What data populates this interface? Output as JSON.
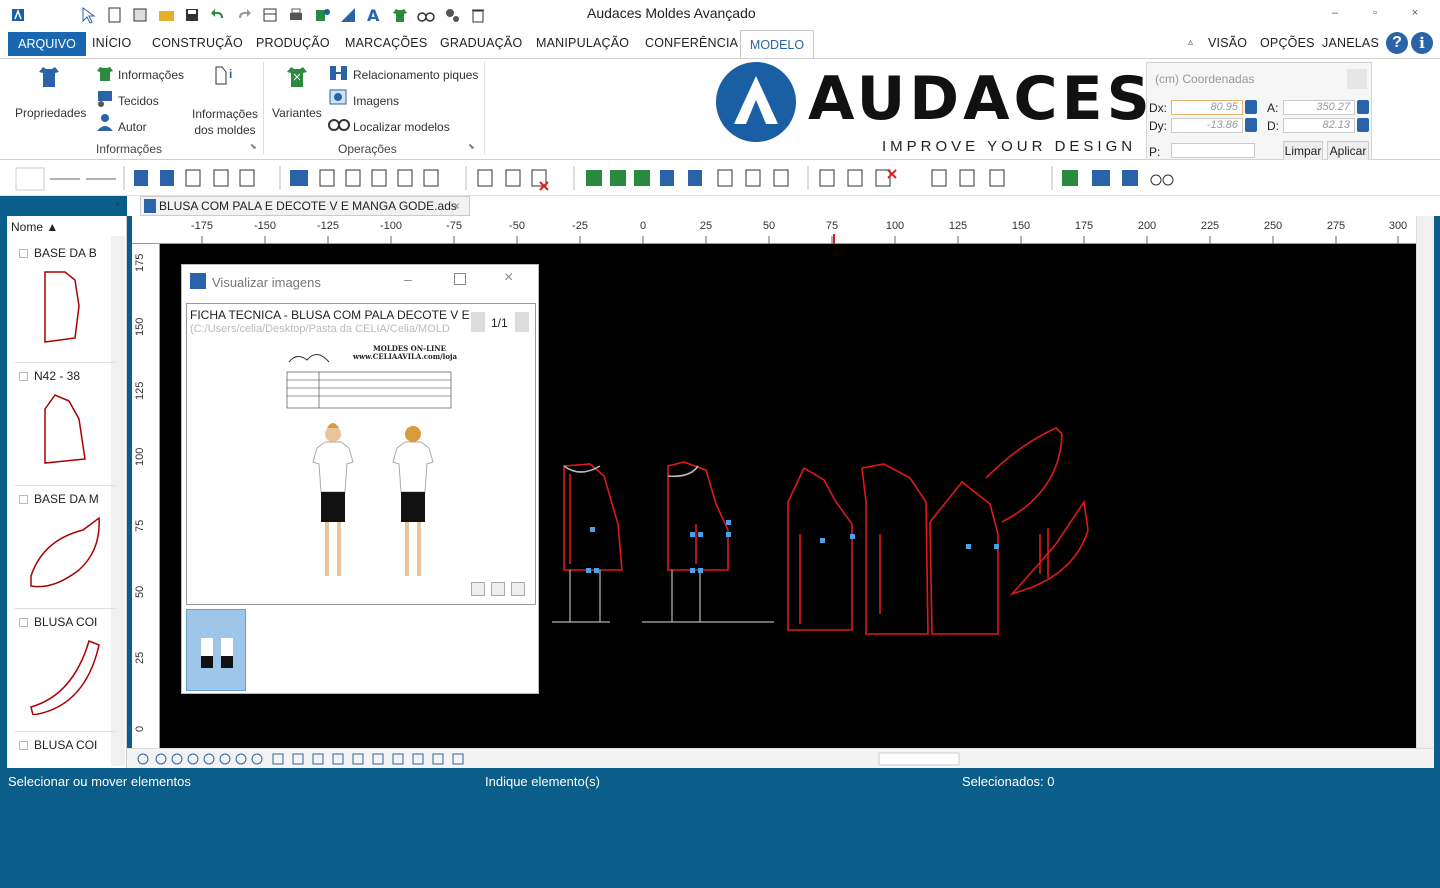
{
  "app": {
    "title": "Audaces Moldes Avançado",
    "minimize": "–",
    "restore": "▫",
    "close": "×"
  },
  "ribbon_tabs": [
    "ARQUIVO",
    "INÍCIO",
    "CONSTRUÇÃO",
    "PRODUÇÃO",
    "MARCAÇÕES",
    "GRADUAÇÃO",
    "MANIPULAÇÃO",
    "CONFERÊNCIA",
    "MODELO"
  ],
  "active_tab": "MODELO",
  "right_menu": {
    "visao": "VISÃO",
    "opcoes": "OPÇÕES",
    "janelas": "JANELAS"
  },
  "ribbon": {
    "propriedades": "Propriedades",
    "informacoes": "Informações",
    "tecidos": "Tecidos",
    "autor": "Autor",
    "informacoes_moldes": "Informações dos moldes",
    "group_informacoes": "Informações",
    "variantes": "Variantes",
    "relacionamento": "Relacionamento piques",
    "imagens": "Imagens",
    "localizar": "Localizar modelos",
    "group_operacoes": "Operações"
  },
  "logo": {
    "word": "AUDACES",
    "tagline": "IMPROVE YOUR DESIGN"
  },
  "coords": {
    "header": "(cm) Coordenadas",
    "dx_label": "Dx:",
    "dx": "80.95",
    "dy_label": "Dy:",
    "dy": "-13.86",
    "a_label": "A:",
    "a": "350.27",
    "d_label": "D:",
    "d": "82.13",
    "p_label": "P:",
    "limpar": "Limpar",
    "aplicar": "Aplicar"
  },
  "left_panel": {
    "header": "Nome",
    "items": [
      {
        "label": "BASE DA B"
      },
      {
        "label": "N42 - 38"
      },
      {
        "label": "BASE DA M"
      },
      {
        "label": "BLUSA COI"
      },
      {
        "label": "BLUSA COI"
      }
    ]
  },
  "document_tab": "BLUSA COM PALA E DECOTE V E MANGA GODE.ads",
  "ruler": {
    "unit": "cm",
    "h_ticks": [
      "-175",
      "-150",
      "-125",
      "-100",
      "-75",
      "-50",
      "-25",
      "0",
      "25",
      "50",
      "75",
      "100",
      "125",
      "150",
      "175",
      "200",
      "225",
      "250",
      "275",
      "300"
    ],
    "v_ticks": [
      "175",
      "150",
      "125",
      "100",
      "75",
      "50",
      "25",
      "0"
    ]
  },
  "image_dialog": {
    "title": "Visualizar imagens",
    "file_title": "FICHA TECNICA - BLUSA COM PALA DECOTE V E M",
    "file_path": "(C:/Users/celia/Desktop/Pasta da CELIA/Celia/MOLD",
    "page": "1/1",
    "sheet_header": "MOLDES ON-LINE",
    "sheet_site": "www.CELIAAVILA.com/loja"
  },
  "status": {
    "left": "Selecionar ou mover elementos",
    "middle": "Indique elemento(s)",
    "right": "Selecionados: 0"
  },
  "colors": {
    "accent": "#1a66b0",
    "status_bg": "#0b5e8a",
    "pattern_line": "#e01818",
    "point": "#4aa3e8"
  }
}
